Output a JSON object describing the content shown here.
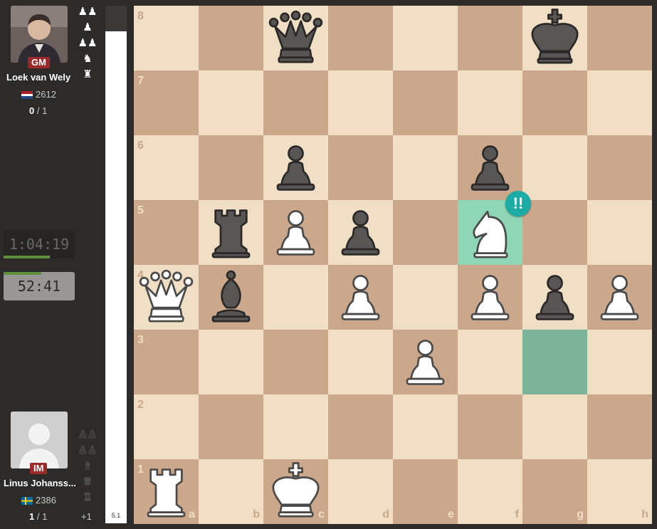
{
  "top_player": {
    "title": "GM",
    "name": "Loek van Wely",
    "rating": "2612",
    "flag": "netherlands-flag",
    "score_pts": "0",
    "score_total": " / 1",
    "captured": [
      "♟♟",
      "♟",
      "♟♟",
      "♞",
      "♜"
    ]
  },
  "bottom_player": {
    "title": "IM",
    "name": "Linus Johanss...",
    "rating": "2386",
    "flag": "sweden-flag",
    "score_pts": "1",
    "score_total": " / 1",
    "captured": [
      "♟♟",
      "♟♟",
      "♝",
      "♛",
      "♜"
    ],
    "material_advantage": "+1"
  },
  "clocks": {
    "top": "1:04:19",
    "bottom": "52:41",
    "top_progress": 0.65,
    "bottom_progress": 0.53
  },
  "move_list": {
    "last_move": "5.1"
  },
  "board": {
    "files": [
      "a",
      "b",
      "c",
      "d",
      "e",
      "f",
      "g",
      "h"
    ],
    "ranks": [
      "8",
      "7",
      "6",
      "5",
      "4",
      "3",
      "2",
      "1"
    ],
    "highlight_from": "g3",
    "highlight_to": "f5",
    "annotation": "!!",
    "annotation_square": "f5",
    "pieces": [
      {
        "sq": "c8",
        "type": "queen",
        "color": "black"
      },
      {
        "sq": "g8",
        "type": "king",
        "color": "black"
      },
      {
        "sq": "c6",
        "type": "pawn",
        "color": "black"
      },
      {
        "sq": "f6",
        "type": "pawn",
        "color": "black"
      },
      {
        "sq": "b5",
        "type": "rook",
        "color": "black"
      },
      {
        "sq": "c5",
        "type": "pawn",
        "color": "white"
      },
      {
        "sq": "d5",
        "type": "pawn",
        "color": "black"
      },
      {
        "sq": "f5",
        "type": "knight",
        "color": "white"
      },
      {
        "sq": "a4",
        "type": "queen",
        "color": "white"
      },
      {
        "sq": "b4",
        "type": "bishop",
        "color": "black"
      },
      {
        "sq": "d4",
        "type": "pawn",
        "color": "white"
      },
      {
        "sq": "f4",
        "type": "pawn",
        "color": "white"
      },
      {
        "sq": "g4",
        "type": "pawn",
        "color": "black"
      },
      {
        "sq": "h4",
        "type": "pawn",
        "color": "white"
      },
      {
        "sq": "e3",
        "type": "pawn",
        "color": "white"
      },
      {
        "sq": "a1",
        "type": "rook",
        "color": "white"
      },
      {
        "sq": "c1",
        "type": "king",
        "color": "white"
      }
    ]
  },
  "colors": {
    "light_square": "#f0dfc5",
    "dark_square": "#cba88c",
    "highlight_from": "#7bb298",
    "highlight_to": "#8ed6b6",
    "brilliant_badge": "#1baca6",
    "title_badge": "#9c2a2a"
  }
}
